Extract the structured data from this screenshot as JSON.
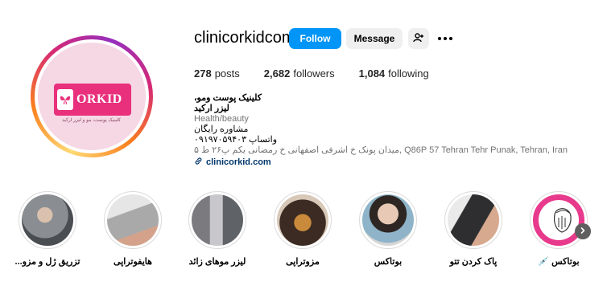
{
  "profile": {
    "username": "clinicorkidcom",
    "avatar_brand": "ORKID",
    "avatar_sub": "کلینیک پوست، مو و لیزر ارکید",
    "buttons": {
      "follow": "Follow",
      "message": "Message"
    },
    "stats": {
      "posts_count": "278",
      "posts_label": "posts",
      "followers_count": "2,682",
      "followers_label": "followers",
      "following_count": "1,084",
      "following_label": "following"
    },
    "bio": {
      "name": "کلینیک پوست ومو، لیزر ارکید",
      "category": "Health/beauty",
      "line1": "مشاوره رایگان",
      "line2": "واتساپ ۰۹۱۹۷۰۵۹۴۰۳",
      "address": "میدان پونک خ اشرفی اصفهانی خ رمضانی یکم پ۲۶ ط ۵, Q86P 57 Tehran Tehr Punak, Tehran, Iran",
      "link": "clinicorkid.com"
    }
  },
  "highlights": [
    {
      "label": "تزریق ژل و مزو...",
      "bg": "#6b6f73"
    },
    {
      "label": "هایفوتراپی",
      "bg": "#b9b9b9"
    },
    {
      "label": "لیزر موهای زائد",
      "bg": "#8e8e93"
    },
    {
      "label": "مزوتراپی",
      "bg": "#5d4a3b"
    },
    {
      "label": "بوتاکس",
      "bg": "#cfc6c2"
    },
    {
      "label": "پاک کردن تتو",
      "bg": "#3a3a3a"
    },
    {
      "label": "بوتاکس 💉",
      "bg": "#ffffff"
    }
  ],
  "icons": {
    "add_user": "add-user-icon",
    "more": "more-options-icon",
    "link": "link-icon",
    "next": "chevron-right-icon"
  },
  "colors": {
    "follow_button": "#0095f6",
    "secondary_button": "#efefef",
    "link": "#00376b",
    "brand_pink": "#e8307c"
  }
}
